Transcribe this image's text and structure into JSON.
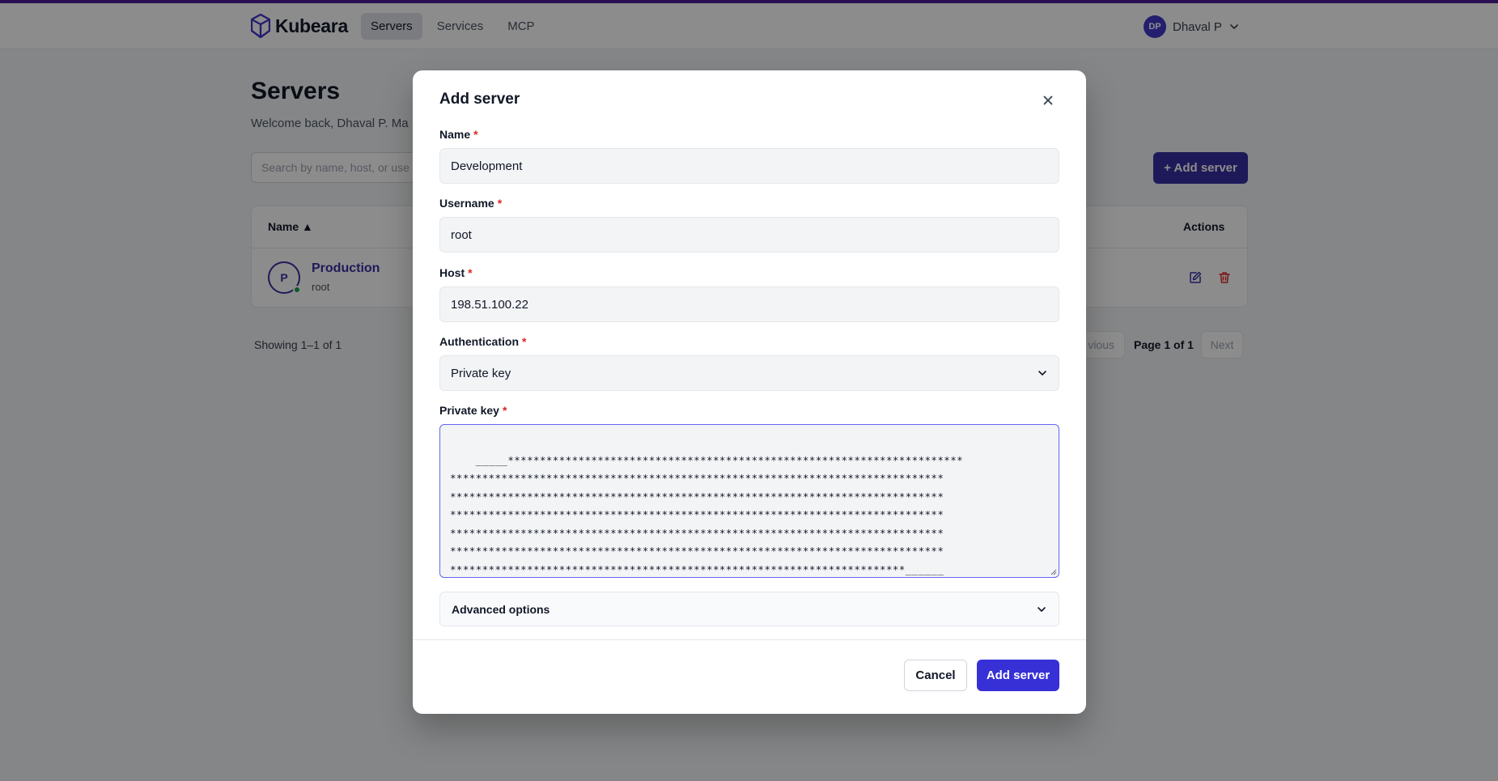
{
  "app": {
    "brand": "Kubeara",
    "accent_color": "#3730d6",
    "nav": [
      {
        "label": "Servers",
        "active": true
      },
      {
        "label": "Services",
        "active": false
      },
      {
        "label": "MCP",
        "active": false
      }
    ],
    "user": {
      "initials": "DP",
      "name": "Dhaval P"
    }
  },
  "page": {
    "title": "Servers",
    "subtitle": "Welcome back, Dhaval P. Ma",
    "search_placeholder": "Search by name, host, or use",
    "add_button": "+ Add server",
    "table": {
      "columns": [
        "Name ▲",
        "Actions"
      ],
      "rows": [
        {
          "initial": "P",
          "name": "Production",
          "username": "root",
          "status_color": "#16a34a"
        }
      ]
    },
    "showing": "Showing 1–1 of 1",
    "pagination": {
      "prev": "vious",
      "info": "Page 1 of 1",
      "next": "Next"
    }
  },
  "modal": {
    "title": "Add server",
    "close_icon": "close-icon",
    "fields": {
      "name": {
        "label": "Name",
        "required": "*",
        "value": "Development"
      },
      "username": {
        "label": "Username",
        "required": "*",
        "value": "root"
      },
      "host": {
        "label": "Host",
        "required": "*",
        "value": "198.51.100.22"
      },
      "authentication": {
        "label": "Authentication",
        "required": "*",
        "value": "Private key"
      },
      "private_key": {
        "label": "Private key",
        "required": "*",
        "value": "_____***********************************************************************\n*****************************************************************************\n*****************************************************************************\n*****************************************************************************\n*****************************************************************************\n*****************************************************************************\n***********************************************************************______"
      }
    },
    "advanced_label": "Advanced options",
    "cancel_label": "Cancel",
    "submit_label": "Add server"
  }
}
